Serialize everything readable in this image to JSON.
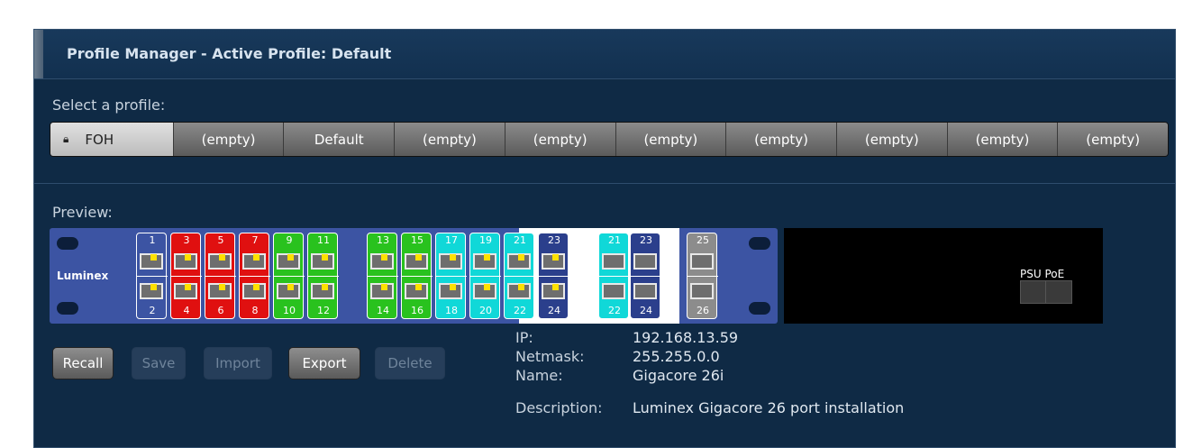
{
  "header": {
    "title": "Profile Manager - Active Profile: Default"
  },
  "profiles": {
    "label": "Select a profile:",
    "items": [
      {
        "label": "FOH",
        "locked": true,
        "active": true
      },
      {
        "label": "(empty)"
      },
      {
        "label": "Default"
      },
      {
        "label": "(empty)"
      },
      {
        "label": "(empty)"
      },
      {
        "label": "(empty)"
      },
      {
        "label": "(empty)"
      },
      {
        "label": "(empty)"
      },
      {
        "label": "(empty)"
      },
      {
        "label": "(empty)"
      }
    ]
  },
  "preview": {
    "label": "Preview:",
    "brand": "Luminex",
    "psu_label": "PSU PoE",
    "ports": [
      {
        "top": "1",
        "bottom": "2",
        "color": "#3c54a3"
      },
      {
        "top": "3",
        "bottom": "4",
        "color": "#e01010"
      },
      {
        "top": "5",
        "bottom": "6",
        "color": "#e01010"
      },
      {
        "top": "7",
        "bottom": "8",
        "color": "#e01010"
      },
      {
        "top": "9",
        "bottom": "10",
        "color": "#29c21e"
      },
      {
        "top": "11",
        "bottom": "12",
        "color": "#29c21e"
      },
      {
        "top": "13",
        "bottom": "14",
        "color": "#29c21e"
      },
      {
        "top": "15",
        "bottom": "16",
        "color": "#29c21e"
      },
      {
        "top": "17",
        "bottom": "18",
        "color": "#10d8d8"
      },
      {
        "top": "19",
        "bottom": "20",
        "color": "#10d8d8"
      },
      {
        "top": "21",
        "bottom": "22",
        "color": "#10d8d8"
      },
      {
        "top": "23",
        "bottom": "24",
        "color": "#2b3f8c"
      },
      {
        "top": "21",
        "bottom": "22",
        "color": "#10d8d8"
      },
      {
        "top": "23",
        "bottom": "24",
        "color": "#2b3f8c"
      },
      {
        "top": "25",
        "bottom": "26",
        "color": "#8c8c8c"
      }
    ]
  },
  "actions": {
    "recall": "Recall",
    "save": "Save",
    "import": "Import",
    "export": "Export",
    "delete": "Delete"
  },
  "info": {
    "ip_label": "IP:",
    "ip": "192.168.13.59",
    "netmask_label": "Netmask:",
    "netmask": "255.255.0.0",
    "name_label": "Name:",
    "name": "Gigacore 26i",
    "description_label": "Description:",
    "description": "Luminex Gigacore 26 port installation"
  }
}
